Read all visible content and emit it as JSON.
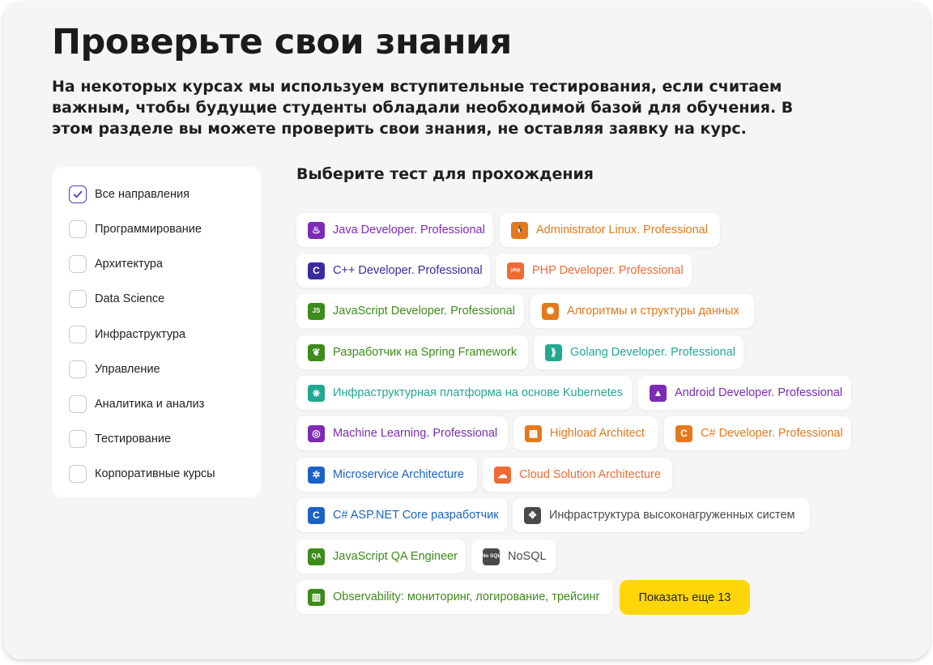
{
  "page": {
    "title": "Проверьте свои знания",
    "description": "На некоторых курсах мы используем вступительные тестирования, если считаем важным, чтобы будущие студенты обладали необходимой базой для обучения. В этом разделе вы можете проверить свои знания, не оставляя заявку на курс."
  },
  "filters": [
    {
      "label": "Все направления",
      "checked": true
    },
    {
      "label": "Программирование",
      "checked": false
    },
    {
      "label": "Архитектура",
      "checked": false
    },
    {
      "label": "Data Science",
      "checked": false
    },
    {
      "label": "Инфраструктура",
      "checked": false
    },
    {
      "label": "Управление",
      "checked": false
    },
    {
      "label": "Аналитика и анализ",
      "checked": false
    },
    {
      "label": "Тестирование",
      "checked": false
    },
    {
      "label": "Корпоративные курсы",
      "checked": false
    }
  ],
  "tests_section": {
    "title": "Выберите тест для прохождения",
    "show_more_label": "Показать еще 13"
  },
  "tests": [
    {
      "label": "Java Developer. Professional",
      "icon": "java-icon",
      "color": "#7b2bb5",
      "icon_bg": "#7b2bb5",
      "glyph": "♨"
    },
    {
      "label": "Administrator Linux. Professional",
      "icon": "linux-icon",
      "color": "#e3791b",
      "icon_bg": "#e3791b",
      "glyph": "🐧"
    },
    {
      "label": "C++ Developer. Professional",
      "icon": "cpp-icon",
      "color": "#3a2aa0",
      "icon_bg": "#3a2aa0",
      "glyph": "C"
    },
    {
      "label": "PHP Developer. Professional",
      "icon": "php-icon",
      "color": "#f06a34",
      "icon_bg": "#f06a34",
      "glyph": "php"
    },
    {
      "label": "JavaScript Developer. Professional",
      "icon": "javascript-icon",
      "color": "#3d8b1a",
      "icon_bg": "#3d8b1a",
      "glyph": "JS"
    },
    {
      "label": "Алгоритмы и структуры данных",
      "icon": "algorithms-icon",
      "color": "#e3791b",
      "icon_bg": "#e3791b",
      "glyph": "✺"
    },
    {
      "label": "Разработчик на Spring Framework",
      "icon": "spring-icon",
      "color": "#3d8b1a",
      "icon_bg": "#3d8b1a",
      "glyph": "❦"
    },
    {
      "label": "Golang Developer. Professional",
      "icon": "golang-icon",
      "color": "#21a98f",
      "icon_bg": "#21a98f",
      "glyph": "⟫"
    },
    {
      "label": "Инфраструктурная платформа на основе Kubernetes",
      "icon": "kubernetes-icon",
      "color": "#21a98f",
      "icon_bg": "#21a98f",
      "glyph": "⎈"
    },
    {
      "label": "Android Developer. Professional",
      "icon": "android-icon",
      "color": "#7b2bb5",
      "icon_bg": "#7b2bb5",
      "glyph": "▲"
    },
    {
      "label": "Machine Learning. Professional",
      "icon": "machine-learning-icon",
      "color": "#7b2bb5",
      "icon_bg": "#7b2bb5",
      "glyph": "◎"
    },
    {
      "label": "Highload Architect",
      "icon": "highload-icon",
      "color": "#e3791b",
      "icon_bg": "#e3791b",
      "glyph": "▦"
    },
    {
      "label": "C# Developer. Professional",
      "icon": "csharp-icon",
      "color": "#e3791b",
      "icon_bg": "#e3791b",
      "glyph": "C"
    },
    {
      "label": "Microservice Architecture",
      "icon": "microservice-icon",
      "color": "#1a62c7",
      "icon_bg": "#1a62c7",
      "glyph": "✲"
    },
    {
      "label": "Cloud Solution Architecture",
      "icon": "cloud-icon",
      "color": "#f06a34",
      "icon_bg": "#f06a34",
      "glyph": "☁"
    },
    {
      "label": "C# ASP.NET Core разработчик",
      "icon": "aspnet-icon",
      "color": "#1a62c7",
      "icon_bg": "#1a62c7",
      "glyph": "C"
    },
    {
      "label": "Инфраструктура высоконагруженных систем",
      "icon": "infrastructure-icon",
      "color": "#4a4a4a",
      "icon_bg": "#4a4a4a",
      "glyph": "✥"
    },
    {
      "label": "JavaScript QA Engineer",
      "icon": "qa-icon",
      "color": "#3d8b1a",
      "icon_bg": "#3d8b1a",
      "glyph": "QA"
    },
    {
      "label": "NoSQL",
      "icon": "nosql-icon",
      "color": "#4a4a4a",
      "icon_bg": "#4a4a4a",
      "glyph": "No SQL"
    },
    {
      "label": "Observability: мониторинг, логирование, трейсинг",
      "icon": "observability-icon",
      "color": "#3d8b1a",
      "icon_bg": "#3d8b1a",
      "glyph": "▥"
    }
  ]
}
